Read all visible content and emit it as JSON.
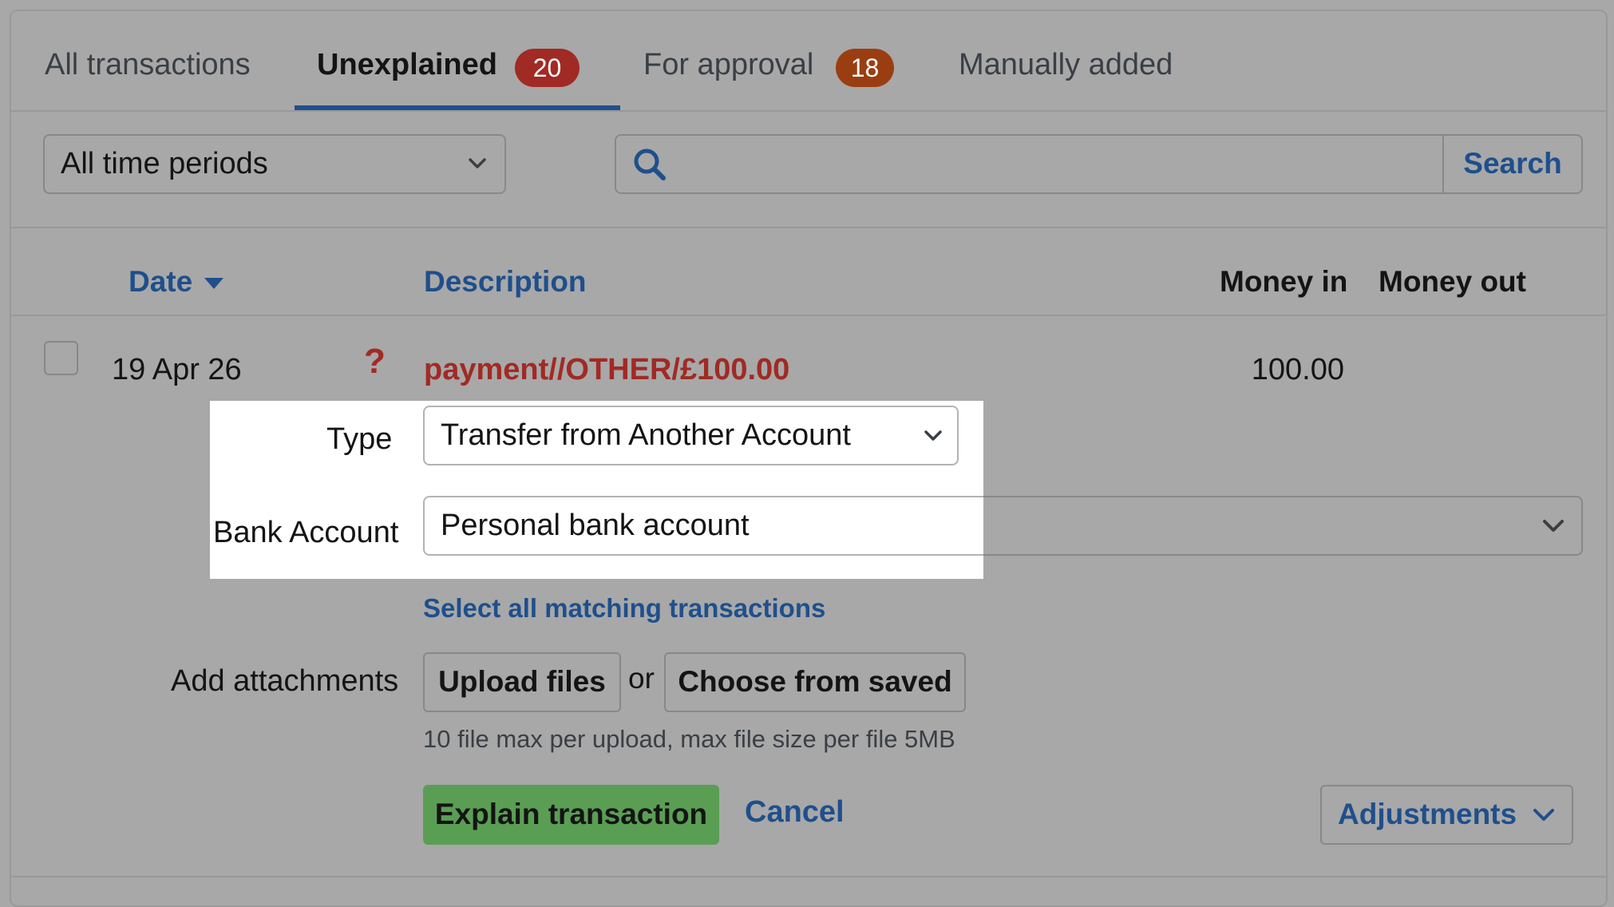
{
  "tabs": [
    {
      "label": "All transactions"
    },
    {
      "label": "Unexplained",
      "count": "20"
    },
    {
      "label": "For approval",
      "count": "18"
    },
    {
      "label": "Manually added"
    }
  ],
  "colors": {
    "badge_unexplained": "#a12a24",
    "badge_approval": "#9a3e12",
    "link": "#1f4f8c",
    "warning": "#a12a24",
    "primary_button": "#5a9e54"
  },
  "filters": {
    "period": "All time periods",
    "search_placeholder": "",
    "search_button": "Search"
  },
  "table": {
    "headers": {
      "date": "Date",
      "description": "Description",
      "money_in": "Money in",
      "money_out": "Money out"
    },
    "row": {
      "date": "19 Apr 26",
      "status_icon": "?",
      "description": "payment//OTHER/£100.00",
      "money_in": "100.00",
      "money_out": ""
    }
  },
  "form": {
    "type_label": "Type",
    "type_value": "Transfer from Another Account",
    "bank_account_label": "Bank Account",
    "bank_account_value": "Personal bank account",
    "select_matching": "Select all matching transactions",
    "attachments_label": "Add attachments",
    "upload_button": "Upload files",
    "or_text": "or",
    "choose_saved_button": "Choose from saved",
    "file_hint": "10 file max per upload, max file size per file 5MB",
    "explain_button": "Explain transaction",
    "cancel_link": "Cancel",
    "adjustments_button": "Adjustments"
  }
}
